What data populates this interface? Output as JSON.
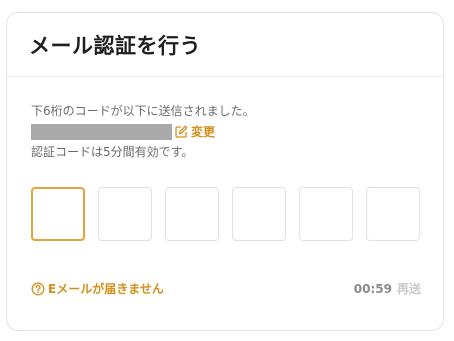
{
  "card": {
    "title": "メール認証を行う"
  },
  "instructions": {
    "sent_message": "下6桁のコードが以下に送信されました。",
    "change_label": "変更",
    "validity_message": "認証コードは5分間有効です。"
  },
  "otp": {
    "digit_count": 6,
    "active_index": 0,
    "values": [
      "",
      "",
      "",
      "",
      "",
      ""
    ]
  },
  "footer": {
    "no_email_label": "Eメールが届きません",
    "timer": "00:59",
    "resend_label": "再送"
  },
  "colors": {
    "accent": "#d4901a",
    "active_border": "#e6a33a",
    "muted_text": "#6b6b6b",
    "disabled_text": "#c9c9c9"
  }
}
